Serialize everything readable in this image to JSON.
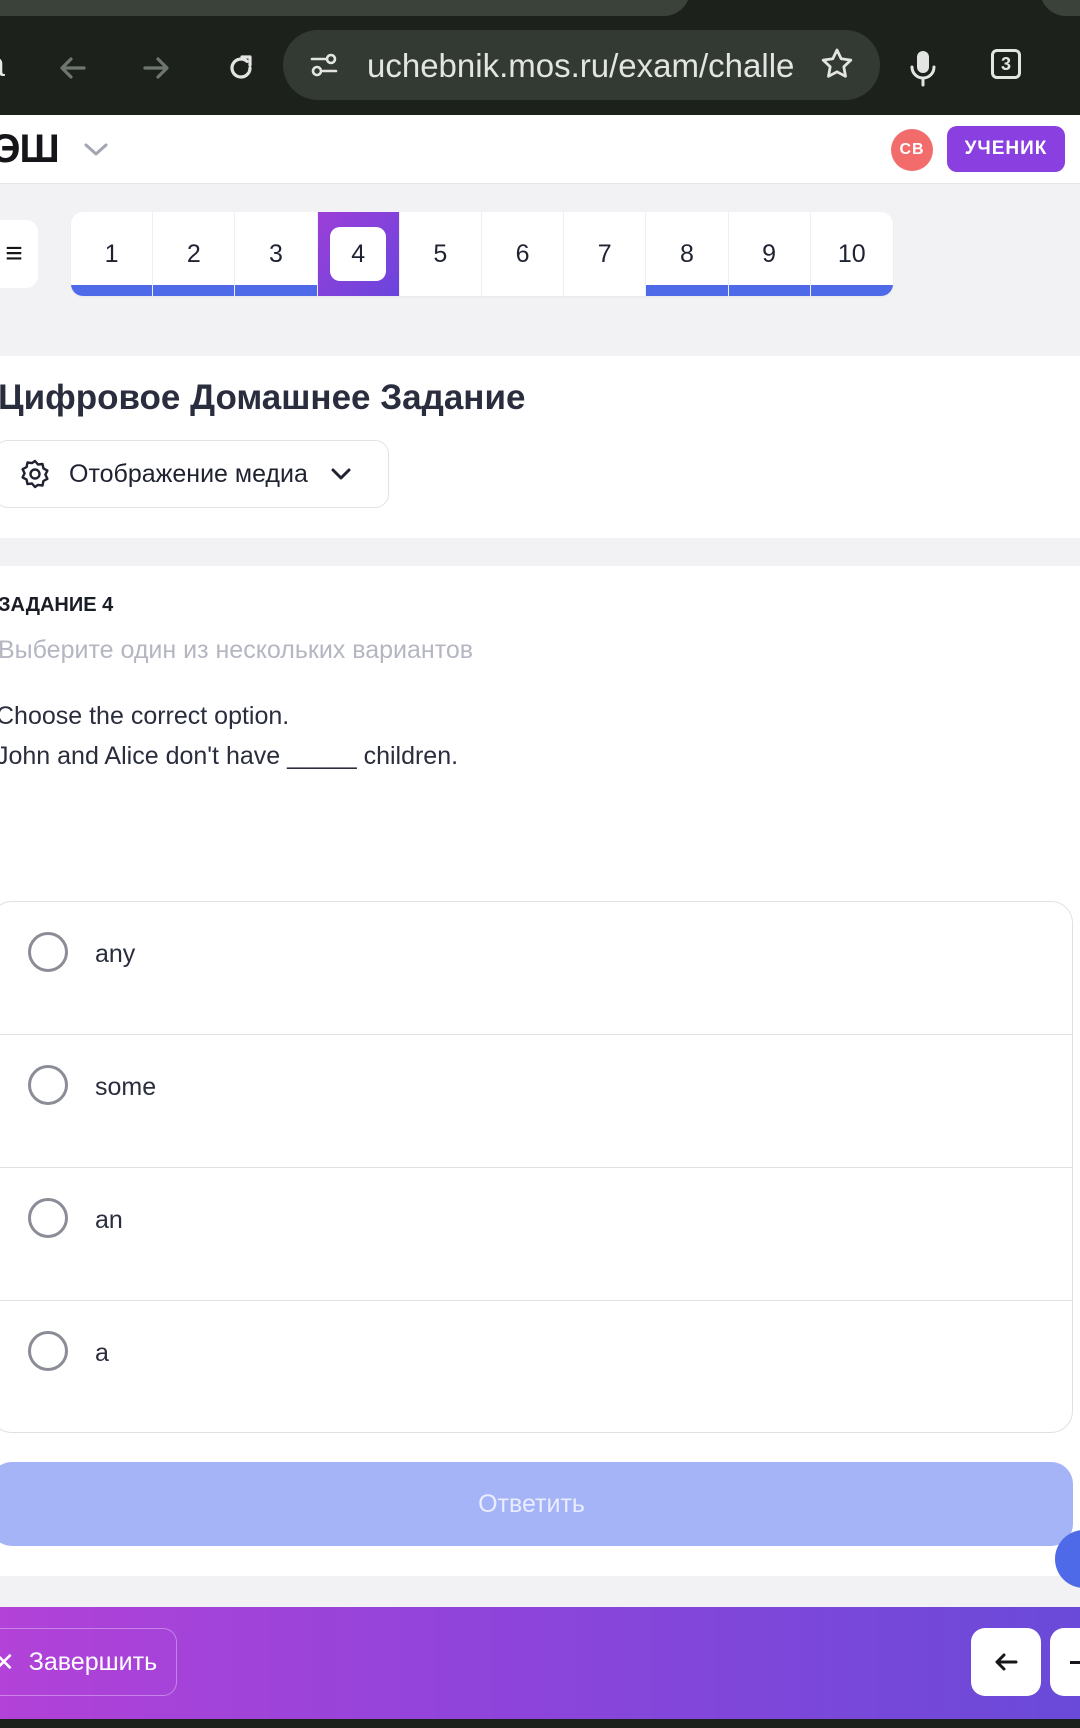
{
  "browser": {
    "tab_fragment": "a",
    "url": "uchebnik.mos.ru/exam/challe",
    "tab_count": "3"
  },
  "header": {
    "logo": "ЭШ",
    "avatar_initials": "СВ",
    "role_badge": "УЧЕНИК"
  },
  "question_nav": {
    "current": "4",
    "items": [
      {
        "label": "1",
        "answered": true
      },
      {
        "label": "2",
        "answered": true
      },
      {
        "label": "3",
        "answered": true
      },
      {
        "label": "4",
        "answered": false
      },
      {
        "label": "5",
        "answered": false
      },
      {
        "label": "6",
        "answered": false
      },
      {
        "label": "7",
        "answered": false
      },
      {
        "label": "8",
        "answered": true
      },
      {
        "label": "9",
        "answered": true
      },
      {
        "label": "10",
        "answered": true
      }
    ]
  },
  "title_card": {
    "title": "Цифровое Домашнее Задание",
    "media_button": "Отображение медиа"
  },
  "task": {
    "label": "ЗАДАНИЕ 4",
    "hint": "Выберите один из нескольких вариантов",
    "instruction": "Choose the correct option.",
    "sentence": "John and Alice don't have _____ children.",
    "options": [
      {
        "label": "any"
      },
      {
        "label": "some"
      },
      {
        "label": "an"
      },
      {
        "label": "a"
      }
    ],
    "submit": "Ответить"
  },
  "footer": {
    "finish": "Завершить"
  },
  "colors": {
    "accent_blue": "#4f6ae8",
    "accent_purple": "#8a3fe0",
    "avatar": "#f26c6c"
  }
}
